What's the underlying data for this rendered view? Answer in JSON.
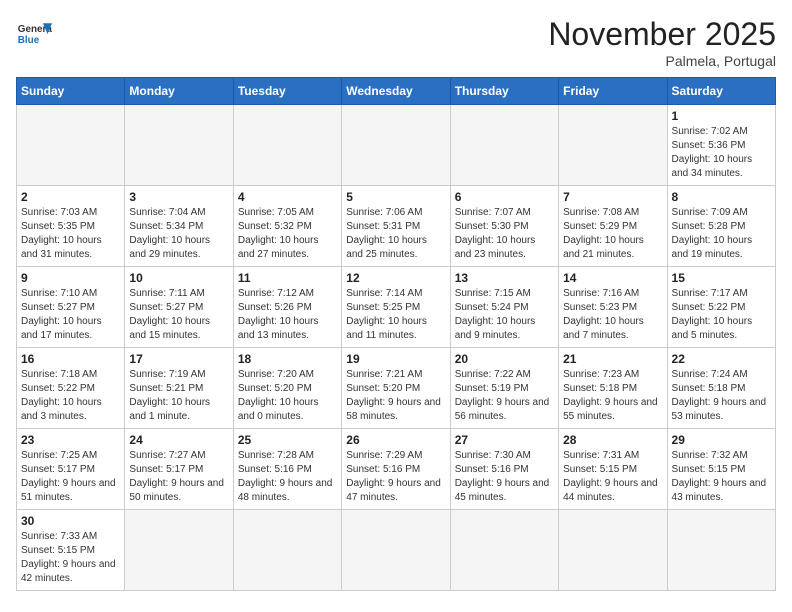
{
  "header": {
    "logo_general": "General",
    "logo_blue": "Blue",
    "month_title": "November 2025",
    "location": "Palmela, Portugal"
  },
  "days_of_week": [
    "Sunday",
    "Monday",
    "Tuesday",
    "Wednesday",
    "Thursday",
    "Friday",
    "Saturday"
  ],
  "weeks": [
    [
      {
        "day": "",
        "info": ""
      },
      {
        "day": "",
        "info": ""
      },
      {
        "day": "",
        "info": ""
      },
      {
        "day": "",
        "info": ""
      },
      {
        "day": "",
        "info": ""
      },
      {
        "day": "",
        "info": ""
      },
      {
        "day": "1",
        "info": "Sunrise: 7:02 AM\nSunset: 5:36 PM\nDaylight: 10 hours and 34 minutes."
      }
    ],
    [
      {
        "day": "2",
        "info": "Sunrise: 7:03 AM\nSunset: 5:35 PM\nDaylight: 10 hours and 31 minutes."
      },
      {
        "day": "3",
        "info": "Sunrise: 7:04 AM\nSunset: 5:34 PM\nDaylight: 10 hours and 29 minutes."
      },
      {
        "day": "4",
        "info": "Sunrise: 7:05 AM\nSunset: 5:32 PM\nDaylight: 10 hours and 27 minutes."
      },
      {
        "day": "5",
        "info": "Sunrise: 7:06 AM\nSunset: 5:31 PM\nDaylight: 10 hours and 25 minutes."
      },
      {
        "day": "6",
        "info": "Sunrise: 7:07 AM\nSunset: 5:30 PM\nDaylight: 10 hours and 23 minutes."
      },
      {
        "day": "7",
        "info": "Sunrise: 7:08 AM\nSunset: 5:29 PM\nDaylight: 10 hours and 21 minutes."
      },
      {
        "day": "8",
        "info": "Sunrise: 7:09 AM\nSunset: 5:28 PM\nDaylight: 10 hours and 19 minutes."
      }
    ],
    [
      {
        "day": "9",
        "info": "Sunrise: 7:10 AM\nSunset: 5:27 PM\nDaylight: 10 hours and 17 minutes."
      },
      {
        "day": "10",
        "info": "Sunrise: 7:11 AM\nSunset: 5:27 PM\nDaylight: 10 hours and 15 minutes."
      },
      {
        "day": "11",
        "info": "Sunrise: 7:12 AM\nSunset: 5:26 PM\nDaylight: 10 hours and 13 minutes."
      },
      {
        "day": "12",
        "info": "Sunrise: 7:14 AM\nSunset: 5:25 PM\nDaylight: 10 hours and 11 minutes."
      },
      {
        "day": "13",
        "info": "Sunrise: 7:15 AM\nSunset: 5:24 PM\nDaylight: 10 hours and 9 minutes."
      },
      {
        "day": "14",
        "info": "Sunrise: 7:16 AM\nSunset: 5:23 PM\nDaylight: 10 hours and 7 minutes."
      },
      {
        "day": "15",
        "info": "Sunrise: 7:17 AM\nSunset: 5:22 PM\nDaylight: 10 hours and 5 minutes."
      }
    ],
    [
      {
        "day": "16",
        "info": "Sunrise: 7:18 AM\nSunset: 5:22 PM\nDaylight: 10 hours and 3 minutes."
      },
      {
        "day": "17",
        "info": "Sunrise: 7:19 AM\nSunset: 5:21 PM\nDaylight: 10 hours and 1 minute."
      },
      {
        "day": "18",
        "info": "Sunrise: 7:20 AM\nSunset: 5:20 PM\nDaylight: 10 hours and 0 minutes."
      },
      {
        "day": "19",
        "info": "Sunrise: 7:21 AM\nSunset: 5:20 PM\nDaylight: 9 hours and 58 minutes."
      },
      {
        "day": "20",
        "info": "Sunrise: 7:22 AM\nSunset: 5:19 PM\nDaylight: 9 hours and 56 minutes."
      },
      {
        "day": "21",
        "info": "Sunrise: 7:23 AM\nSunset: 5:18 PM\nDaylight: 9 hours and 55 minutes."
      },
      {
        "day": "22",
        "info": "Sunrise: 7:24 AM\nSunset: 5:18 PM\nDaylight: 9 hours and 53 minutes."
      }
    ],
    [
      {
        "day": "23",
        "info": "Sunrise: 7:25 AM\nSunset: 5:17 PM\nDaylight: 9 hours and 51 minutes."
      },
      {
        "day": "24",
        "info": "Sunrise: 7:27 AM\nSunset: 5:17 PM\nDaylight: 9 hours and 50 minutes."
      },
      {
        "day": "25",
        "info": "Sunrise: 7:28 AM\nSunset: 5:16 PM\nDaylight: 9 hours and 48 minutes."
      },
      {
        "day": "26",
        "info": "Sunrise: 7:29 AM\nSunset: 5:16 PM\nDaylight: 9 hours and 47 minutes."
      },
      {
        "day": "27",
        "info": "Sunrise: 7:30 AM\nSunset: 5:16 PM\nDaylight: 9 hours and 45 minutes."
      },
      {
        "day": "28",
        "info": "Sunrise: 7:31 AM\nSunset: 5:15 PM\nDaylight: 9 hours and 44 minutes."
      },
      {
        "day": "29",
        "info": "Sunrise: 7:32 AM\nSunset: 5:15 PM\nDaylight: 9 hours and 43 minutes."
      }
    ],
    [
      {
        "day": "30",
        "info": "Sunrise: 7:33 AM\nSunset: 5:15 PM\nDaylight: 9 hours and 42 minutes."
      },
      {
        "day": "",
        "info": ""
      },
      {
        "day": "",
        "info": ""
      },
      {
        "day": "",
        "info": ""
      },
      {
        "day": "",
        "info": ""
      },
      {
        "day": "",
        "info": ""
      },
      {
        "day": "",
        "info": ""
      }
    ]
  ]
}
